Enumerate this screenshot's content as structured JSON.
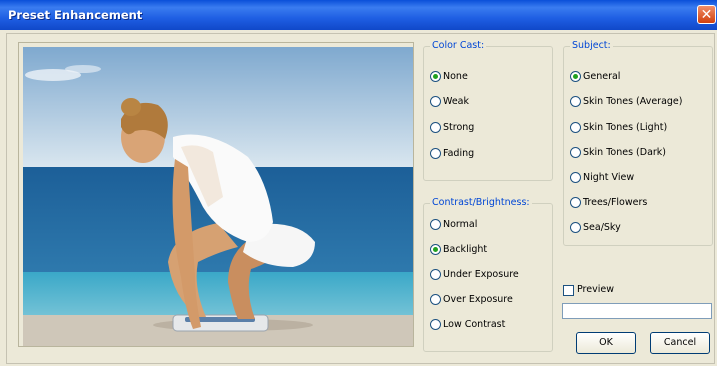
{
  "window": {
    "title": "Preset Enhancement",
    "close_symbol": "✕"
  },
  "color_cast": {
    "legend": "Color Cast:",
    "options": [
      {
        "label": "None",
        "selected": true
      },
      {
        "label": "Weak",
        "selected": false
      },
      {
        "label": "Strong",
        "selected": false
      },
      {
        "label": "Fading",
        "selected": false
      }
    ]
  },
  "contrast": {
    "legend": "Contrast/Brightness:",
    "options": [
      {
        "label": "Normal",
        "selected": false
      },
      {
        "label": "Backlight",
        "selected": true
      },
      {
        "label": "Under Exposure",
        "selected": false
      },
      {
        "label": "Over Exposure",
        "selected": false
      },
      {
        "label": "Low Contrast",
        "selected": false
      }
    ]
  },
  "subject": {
    "legend": "Subject:",
    "options": [
      {
        "label": "General",
        "selected": true
      },
      {
        "label": "Skin Tones (Average)",
        "selected": false
      },
      {
        "label": "Skin Tones (Light)",
        "selected": false
      },
      {
        "label": "Skin Tones (Dark)",
        "selected": false
      },
      {
        "label": "Night View",
        "selected": false
      },
      {
        "label": "Trees/Flowers",
        "selected": false
      },
      {
        "label": "Sea/Sky",
        "selected": false
      }
    ]
  },
  "preview": {
    "label": "Preview",
    "checked": false,
    "value": ""
  },
  "buttons": {
    "ok": "OK",
    "cancel": "Cancel"
  },
  "colors": {
    "title_bar": "#1f5fe3",
    "legend_text": "#0046d5",
    "dialog_bg": "#ece9d8",
    "radio_selected": "#21a121"
  }
}
